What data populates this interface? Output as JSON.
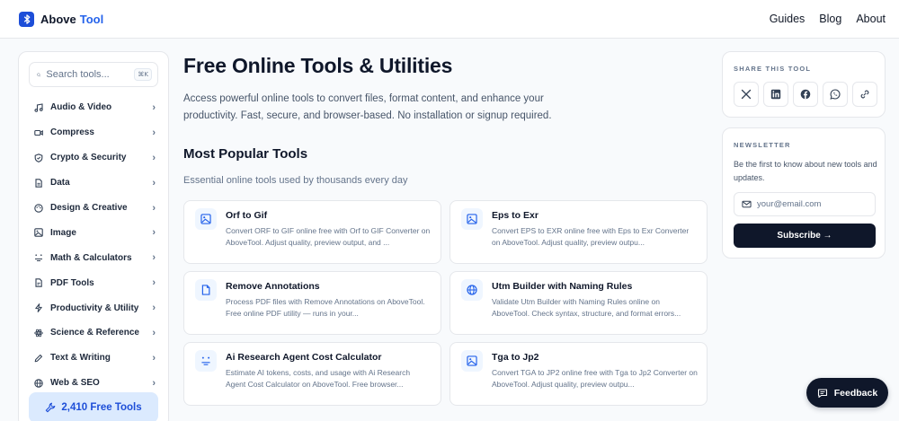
{
  "header": {
    "brand_part1": "Above",
    "brand_part2": "Tool",
    "nav": [
      "Guides",
      "Blog",
      "About"
    ]
  },
  "sidebar": {
    "search_placeholder": "Search tools...",
    "search_shortcut": "⌘K",
    "categories": [
      {
        "label": "Audio & Video",
        "icon": "music-note-icon"
      },
      {
        "label": "Compress",
        "icon": "video-camera-icon"
      },
      {
        "label": "Crypto & Security",
        "icon": "shield-icon"
      },
      {
        "label": "Data",
        "icon": "document-icon"
      },
      {
        "label": "Design & Creative",
        "icon": "palette-icon"
      },
      {
        "label": "Image",
        "icon": "image-icon"
      },
      {
        "label": "Math & Calculators",
        "icon": "calculator-icon"
      },
      {
        "label": "PDF Tools",
        "icon": "pdf-file-icon"
      },
      {
        "label": "Productivity & Utility",
        "icon": "lightning-icon"
      },
      {
        "label": "Science & Reference",
        "icon": "atom-icon"
      },
      {
        "label": "Text & Writing",
        "icon": "pencil-icon"
      },
      {
        "label": "Web & SEO",
        "icon": "globe-icon"
      }
    ],
    "free_tools_label": "2,410 Free Tools"
  },
  "main": {
    "title": "Free Online Tools & Utilities",
    "intro": "Access powerful online tools to convert files, format content, and enhance your productivity. Fast, secure, and browser-based. No installation or signup required.",
    "section_title": "Most Popular Tools",
    "section_subtitle": "Essential online tools used by thousands every day",
    "tools": [
      {
        "title": "Orf to Gif",
        "desc": "Convert ORF to GIF online free with Orf to GIF Converter on AboveTool. Adjust quality, preview output, and ...",
        "icon": "image-icon"
      },
      {
        "title": "Eps to Exr",
        "desc": "Convert EPS to EXR online free with Eps to Exr Converter on AboveTool. Adjust quality, preview outpu...",
        "icon": "image-icon"
      },
      {
        "title": "Remove Annotations",
        "desc": "Process PDF files with Remove Annotations on AboveTool. Free online PDF utility — runs in your...",
        "icon": "document-icon"
      },
      {
        "title": "Utm Builder with Naming Rules",
        "desc": "Validate Utm Builder with Naming Rules online on AboveTool. Check syntax, structure, and format errors...",
        "icon": "globe-icon"
      },
      {
        "title": "Ai Research Agent Cost Calculator",
        "desc": "Estimate AI tokens, costs, and usage with Ai Research Agent Cost Calculator on AboveTool. Free browser...",
        "icon": "calculator-icon"
      },
      {
        "title": "Tga to Jp2",
        "desc": "Convert TGA to JP2 online free with Tga to Jp2 Converter on AboveTool. Adjust quality, preview outpu...",
        "icon": "image-icon"
      }
    ]
  },
  "share": {
    "label": "SHARE THIS TOOL",
    "buttons": [
      "x-icon",
      "linkedin-icon",
      "facebook-icon",
      "whatsapp-icon",
      "link-icon"
    ]
  },
  "newsletter": {
    "label": "NEWSLETTER",
    "text": "Be the first to know about new tools and updates.",
    "email_placeholder": "your@email.com",
    "subscribe_label": "Subscribe →"
  },
  "feedback_label": "Feedback",
  "colors": {
    "accent": "#2563eb",
    "dark": "#0f172a",
    "muted": "#64748b",
    "border": "#e5e7eb"
  }
}
